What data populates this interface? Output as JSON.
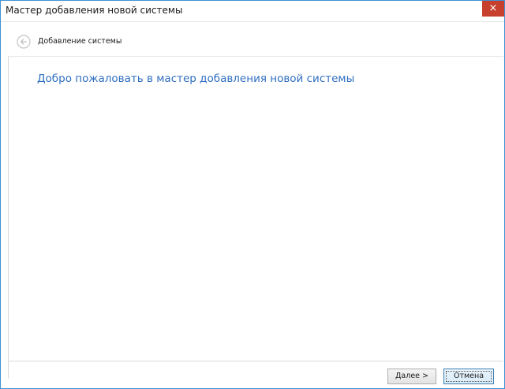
{
  "window": {
    "title": "Мастер добавления новой системы",
    "close_label": "×"
  },
  "nav": {
    "back_icon": "arrow-left-circle-icon",
    "title": "Добавление системы"
  },
  "main": {
    "welcome_text": "Добро пожаловать в мастер добавления новой системы"
  },
  "footer": {
    "next_label": "Далее >",
    "cancel_label": "Отмена"
  },
  "colors": {
    "accent": "#2f6ec0",
    "window_border": "#3c92d6",
    "close_button": "#c7402d"
  }
}
